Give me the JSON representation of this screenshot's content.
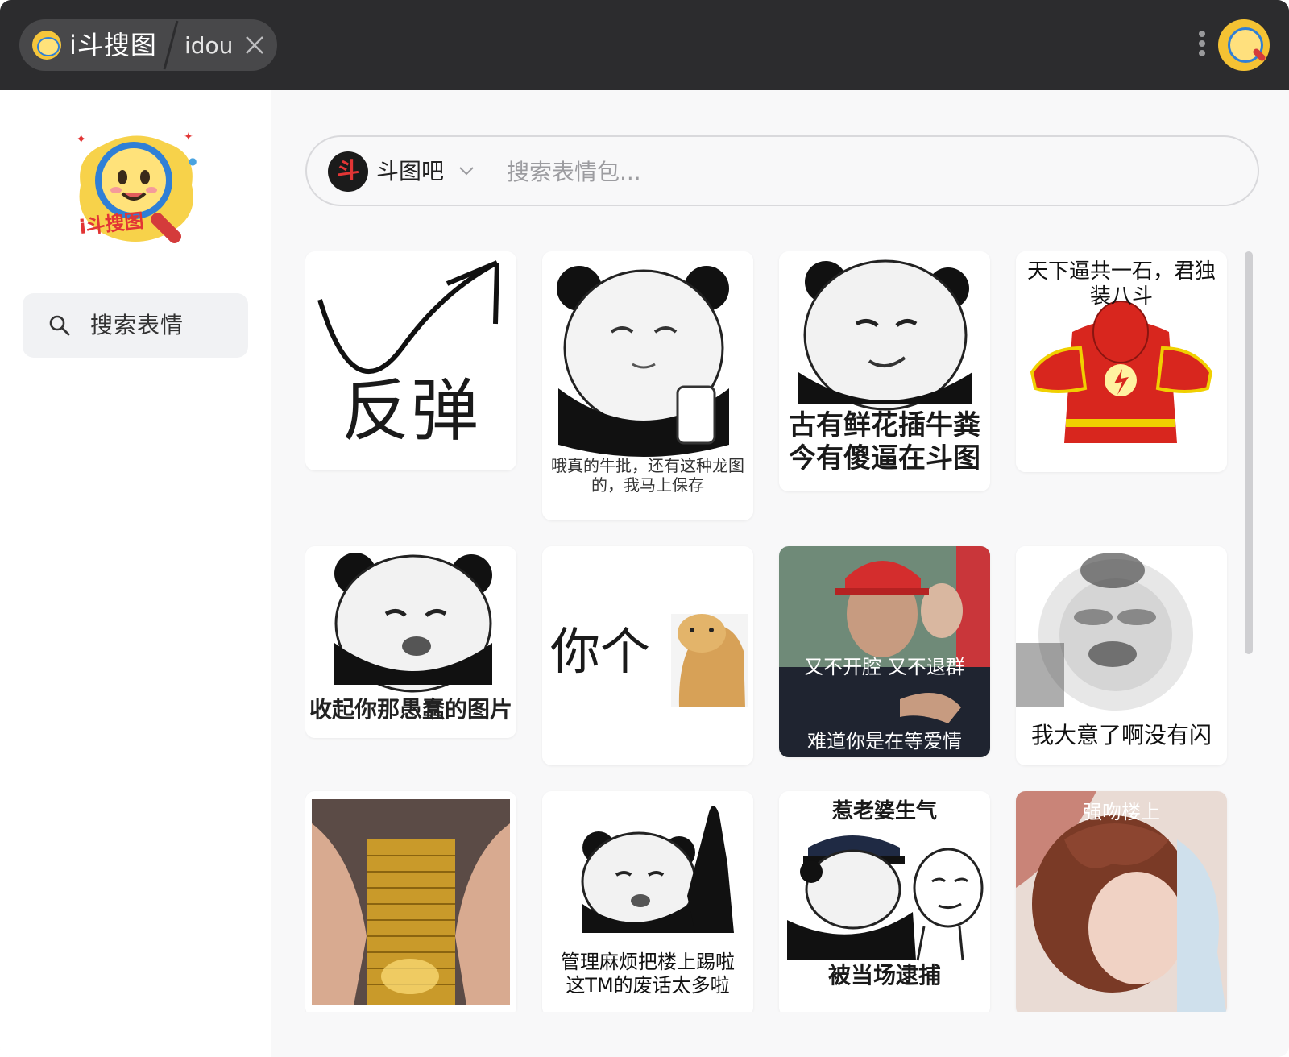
{
  "titlebar": {
    "tab_title": "i斗搜图",
    "tab_sub": "idou"
  },
  "sidebar": {
    "logo_text": "i斗搜图",
    "search_label": "搜索表情"
  },
  "search": {
    "source_name": "斗图吧",
    "source_glyph": "斗",
    "placeholder": "搜索表情包..."
  },
  "memes": [
    {
      "caption": "反弹"
    },
    {
      "caption": "哦真的牛批，还有这种龙图的，我马上保存"
    },
    {
      "caption": "古有鲜花插牛粪今有傻逼在斗图"
    },
    {
      "caption": "天下逼共一石，君独装八斗"
    },
    {
      "caption": "收起你那愚蠢的图片"
    },
    {
      "caption": "你个"
    },
    {
      "caption_top": "又不开腔 又不退群",
      "caption": "难道你是在等爱情"
    },
    {
      "caption": "我大意了啊没有闪"
    },
    {
      "caption": ""
    },
    {
      "caption": "管理麻烦把楼上踢啦这TM的废话太多啦"
    },
    {
      "caption_top": "惹老婆生气",
      "caption": "被当场逮捕"
    },
    {
      "caption": "强吻楼上"
    }
  ],
  "colors": {
    "titlebar": "#2c2c2e",
    "accent": "#2f7fd6",
    "logo_yellow": "#f6c63b"
  }
}
